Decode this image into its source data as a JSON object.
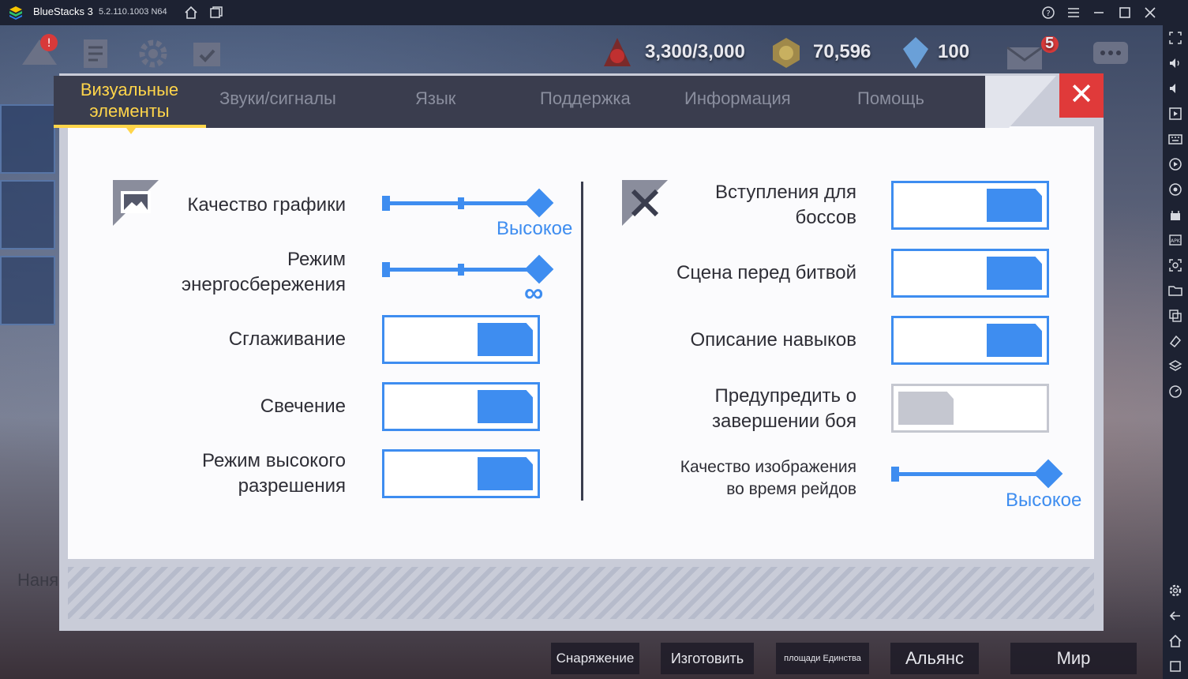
{
  "window": {
    "title": "BlueStacks 3",
    "version": "5.2.110.1003 N64"
  },
  "hud": {
    "energy": "3,300/3,000",
    "gold": "70,596",
    "gems": "100",
    "mail_badge": "5"
  },
  "settings": {
    "tabs": [
      {
        "label": "Визуальные\nэлементы",
        "active": true
      },
      {
        "label": "Звуки/сигналы",
        "active": false
      },
      {
        "label": "Язык",
        "active": false
      },
      {
        "label": "Поддержка",
        "active": false
      },
      {
        "label": "Информация",
        "active": false
      },
      {
        "label": "Помощь",
        "active": false
      }
    ],
    "left": {
      "graphics_quality": {
        "label": "Качество графики",
        "value": "Высокое",
        "level": 1.0
      },
      "power_saving": {
        "label": "Режим\nэнергосбережения",
        "value": "∞",
        "level": 1.0
      },
      "antialiasing": {
        "label": "Сглаживание",
        "on": true
      },
      "glow": {
        "label": "Свечение",
        "on": true
      },
      "high_res": {
        "label": "Режим высокого\nразрешения",
        "on": true
      }
    },
    "right": {
      "boss_intros": {
        "label": "Вступления для\nбоссов",
        "on": true
      },
      "pre_battle_scene": {
        "label": "Сцена перед битвой",
        "on": true
      },
      "skill_description": {
        "label": "Описание навыков",
        "on": true
      },
      "battle_end_warning": {
        "label": "Предупредить о\nзавершении боя",
        "on": false
      },
      "raid_image_quality": {
        "label": "Качество изображения\nво время рейдов",
        "value": "Высокое",
        "level": 1.0
      }
    }
  },
  "game_bottom": {
    "hire_partial": "Наня",
    "tabs": [
      "Снаряжение",
      "Изготовить",
      "площади Единства",
      "Альянс",
      "Мир"
    ]
  },
  "colors": {
    "accent": "#3e8df0",
    "tab_active": "#ffd54a",
    "close": "#e03a3a",
    "toggle_off": "#c5c7d0"
  }
}
